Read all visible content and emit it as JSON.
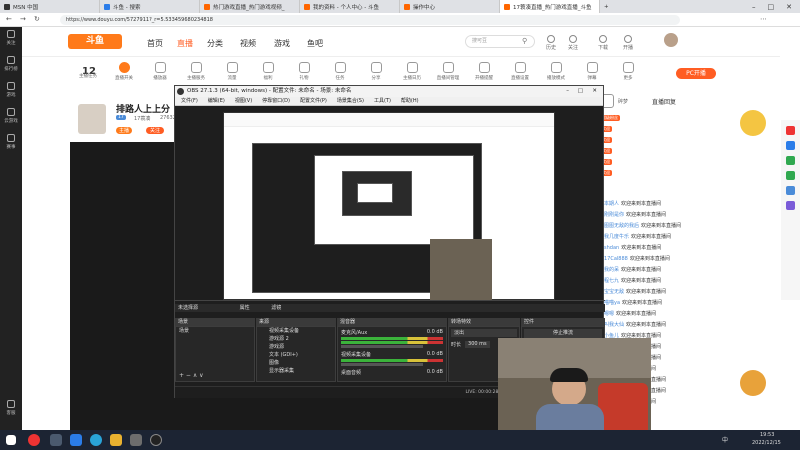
{
  "browser": {
    "tabs": [
      {
        "label": "MSN 中国"
      },
      {
        "label": "斗鱼 - 搜索"
      },
      {
        "label": "热门游戏直播_热门游戏视频_"
      },
      {
        "label": "我的资料 - 个人中心 - 斗鱼"
      },
      {
        "label": "操作中心"
      },
      {
        "label": "17蓑凑直播_热门游戏直播_斗鱼"
      }
    ],
    "url": "https://www.douyu.com/5727911?_r=5.533459680234818"
  },
  "left_sidebar": {
    "items": [
      {
        "label": "关注"
      },
      {
        "label": "排行榜"
      },
      {
        "label": "游戏"
      },
      {
        "label": "云游戏"
      },
      {
        "label": "赛事"
      },
      {
        "label": "客服"
      }
    ]
  },
  "site": {
    "logo": "斗鱼",
    "nav": [
      {
        "label": "首页"
      },
      {
        "label": "直播"
      },
      {
        "label": "分类"
      },
      {
        "label": "视频"
      },
      {
        "label": "游戏"
      },
      {
        "label": "鱼吧"
      }
    ],
    "search_placeholder": "搜可豆",
    "right_icons": [
      {
        "label": "历史"
      },
      {
        "label": "关注"
      },
      {
        "label": "下载"
      },
      {
        "label": "开播"
      }
    ],
    "toolbar": [
      {
        "label": "主播任务"
      },
      {
        "label": "直播开关"
      },
      {
        "label": "播放器"
      },
      {
        "label": "主播服务"
      },
      {
        "label": "流量"
      },
      {
        "label": "福利"
      },
      {
        "label": "礼物"
      },
      {
        "label": "任务"
      },
      {
        "label": "分享"
      },
      {
        "label": "主播日历"
      },
      {
        "label": "直播间管理"
      },
      {
        "label": "开播提醒"
      },
      {
        "label": "直播设置"
      },
      {
        "label": "播放模式"
      },
      {
        "label": "弹幕"
      },
      {
        "label": "更多"
      }
    ],
    "toolbar_count": "12",
    "pc_button": "PC开播"
  },
  "anchor": {
    "name": "排路人上上分",
    "level": "17",
    "room": "17蓑凑",
    "fans": "27632",
    "tag": "主播",
    "follow": "关注"
  },
  "obs": {
    "title": "OBS 27.1.3 (64-bit, windows) - 配置文件: 未命名 - 场景: 未命名",
    "menu": [
      "文件(F)",
      "编辑(E)",
      "视图(V)",
      "停靠窗口(D)",
      "配置文件(P)",
      "场景集合(S)",
      "工具(T)",
      "帮助(H)"
    ],
    "docks": {
      "scenes_title": "场景",
      "sources_title": "来源",
      "mixer_title": "混音器",
      "transitions_title": "转场特效",
      "controls_title": "控件",
      "no_source": "未选择源",
      "props": "属性",
      "filters": "滤镜"
    },
    "scene_item": "场景",
    "sources": [
      {
        "label": "视频采集设备"
      },
      {
        "label": "游戏源 2"
      },
      {
        "label": "游戏源"
      },
      {
        "label": "文本 (GDI+)"
      },
      {
        "label": "图像"
      },
      {
        "label": "显示器采集"
      }
    ],
    "mixer": [
      {
        "label": "麦克风/Aux",
        "db": "0.0 dB"
      },
      {
        "label": "视频采集设备",
        "db": "0.0 dB"
      },
      {
        "label": "桌面音频",
        "db": "0.0 dB"
      }
    ],
    "transition": "淡出",
    "duration_label": "时长",
    "duration": "300 ms",
    "stop_stream": "停止推流",
    "status_live": "LIVE: 00:00:28",
    "status_rec": "REC: 00:00:00",
    "status_cpu": "CPU: 15.6%, 30.00 fps"
  },
  "chat": {
    "header": "直播回复",
    "rank_label": "碎梦",
    "messages": [
      {
        "user": "本期人",
        "text": "欢迎来到本直播间"
      },
      {
        "user": "刚刚是你",
        "text": "欢迎来到本直播间"
      },
      {
        "user": "图图无敌的我后",
        "text": "欢迎来到本直播间"
      },
      {
        "user": "我几度牛乐",
        "text": "欢迎来到本直播间"
      },
      {
        "user": "shdan",
        "text": "欢迎来到本直播间"
      },
      {
        "user": "17Cal888",
        "text": "欢迎来到本直播间"
      },
      {
        "user": "我的呆",
        "text": "欢迎来到本直播间"
      },
      {
        "user": "程七九",
        "text": "欢迎来到本直播间"
      },
      {
        "user": "宝宝无敌",
        "text": "欢迎来到本直播间"
      },
      {
        "user": "喵喵ya",
        "text": "欢迎来到本直播间"
      },
      {
        "user": "嗯嗯",
        "text": "欢迎来到本直播间"
      },
      {
        "user": "叫我大仙",
        "text": "欢迎来到本直播间"
      },
      {
        "user": "小鱼儿",
        "text": "欢迎来到本直播间"
      },
      {
        "user": "五五开",
        "text": "欢迎来到本直播间"
      },
      {
        "user": "路人甲",
        "text": "欢迎来到本直播间"
      },
      {
        "user": "大白",
        "text": "欢迎来到本直播间"
      },
      {
        "user": "我是第一",
        "text": "欢迎来到本直播间"
      },
      {
        "user": "Maaa88",
        "text": "欢迎来到本直播间"
      },
      {
        "user": "小新",
        "text": "欢迎来到本直播间"
      }
    ],
    "badges": [
      "超级粉丝",
      "欢迎",
      "欢迎",
      "欢迎",
      "欢迎",
      "欢迎"
    ]
  },
  "taskbar": {
    "time": "19:53",
    "date": "2022/12/15",
    "lang": "中"
  },
  "colors": {
    "accent": "#ff5d23",
    "obs_bg": "#1e1e1e",
    "taskbar": "#1c2433"
  }
}
